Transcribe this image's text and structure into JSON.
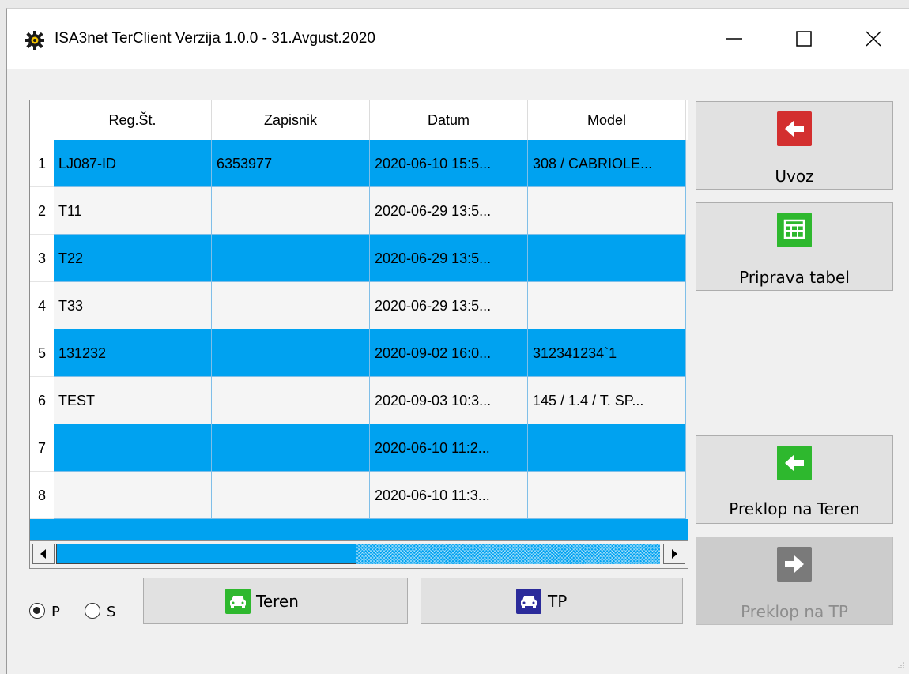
{
  "window": {
    "title": "ISA3net TerClient Verzija 1.0.0 - 31.Avgust.2020",
    "controls": [
      "minimize-icon",
      "maximize-icon",
      "close-icon"
    ]
  },
  "table": {
    "columns": [
      "Reg.Št.",
      "Zapisnik",
      "Datum",
      "Model"
    ],
    "rows": [
      {
        "num": "1",
        "reg": "LJ087-ID",
        "zapisnik": "6353977",
        "datum": "2020-06-10 15:5...",
        "model": "308 / CABRIOLE...",
        "selected": true
      },
      {
        "num": "2",
        "reg": "T11",
        "zapisnik": "",
        "datum": "2020-06-29 13:5...",
        "model": "",
        "selected": false
      },
      {
        "num": "3",
        "reg": "T22",
        "zapisnik": "",
        "datum": "2020-06-29 13:5...",
        "model": "",
        "selected": true
      },
      {
        "num": "4",
        "reg": "T33",
        "zapisnik": "",
        "datum": "2020-06-29 13:5...",
        "model": "",
        "selected": false
      },
      {
        "num": "5",
        "reg": "131232",
        "zapisnik": "",
        "datum": "2020-09-02 16:0...",
        "model": "312341234`1",
        "selected": true
      },
      {
        "num": "6",
        "reg": "TEST",
        "zapisnik": "",
        "datum": "2020-09-03 10:3...",
        "model": "145 / 1.4 / T. SP...",
        "selected": false
      },
      {
        "num": "7",
        "reg": "",
        "zapisnik": "",
        "datum": "2020-06-10 11:2...",
        "model": "",
        "selected": true
      },
      {
        "num": "8",
        "reg": "",
        "zapisnik": "",
        "datum": "2020-06-10 11:3...",
        "model": "",
        "selected": false
      }
    ]
  },
  "buttons": {
    "uvoz": "Uvoz",
    "priprava": "Priprava tabel",
    "preklop_teren": "Preklop na Teren",
    "preklop_tp": "Preklop na TP",
    "teren": "Teren",
    "tp": "TP"
  },
  "radio": {
    "p_label": "P",
    "s_label": "S",
    "selected": "P"
  },
  "colors": {
    "selection": "#00a2f0",
    "uvoz_icon": "#d32f2f",
    "green_icon": "#2eb82e",
    "tp_icon": "#2b2b9a",
    "disabled_icon": "#7a7a7a"
  }
}
